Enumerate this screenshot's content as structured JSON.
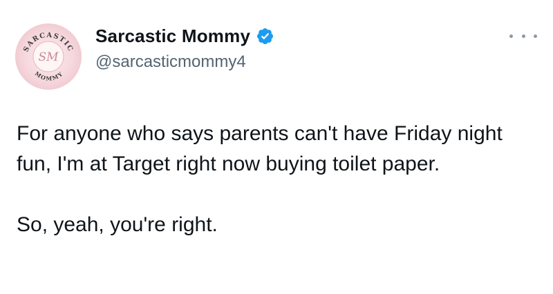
{
  "tweet": {
    "author": {
      "display_name": "Sarcastic Mommy",
      "handle": "@sarcasticmommy4",
      "verified": true,
      "avatar": {
        "icon": "sarcastic-mommy-logo",
        "text_top": "SARCASTIC",
        "text_bottom": "MOMMY",
        "monogram": "SM"
      }
    },
    "more_icon": "more-horizontal-icon",
    "body": {
      "paragraph_1": "For anyone who says parents can't have Friday night fun, I'm at Target right now buying toilet paper.",
      "paragraph_2": "So, yeah, you're right."
    }
  },
  "colors": {
    "text_primary": "#0f1419",
    "text_secondary": "#536471",
    "verified_blue": "#1d9bf0",
    "avatar_pink": "#f6d9de",
    "avatar_accent": "#c98a96"
  }
}
